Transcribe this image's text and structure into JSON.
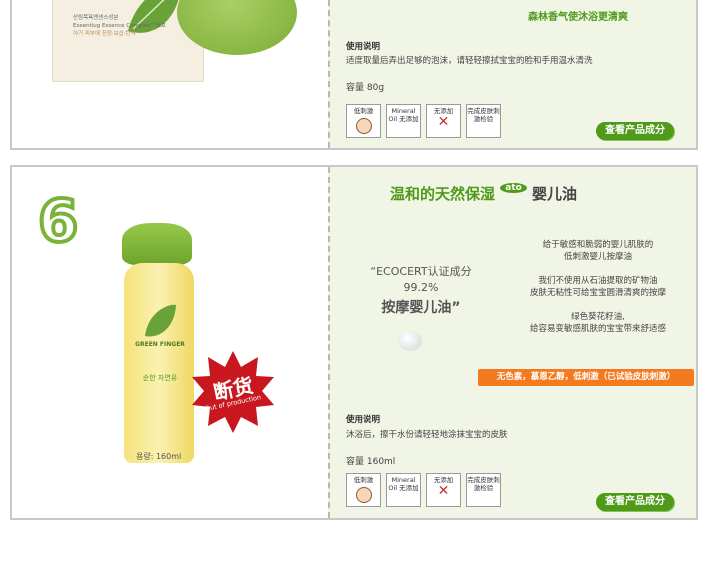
{
  "card1": {
    "tagline": "森林香气使沐浴更清爽",
    "box_text": [
      "산림목욕엔센스성분",
      "Eseentiug Essence Complex™포호",
      "아기 피부에 진정·보습·탄력"
    ],
    "usage_title": "使用说明",
    "usage_text": "适度取量后弄出足够的泡沫，请轻轻擦拭宝宝的脸和手用温水清洗",
    "capacity": "容量 80g",
    "badges": [
      "低刺激",
      "Mineral Oil 无添加",
      "无添加",
      "完成皮肤刺激检验"
    ],
    "button_label": "查看产品成分"
  },
  "card2": {
    "number": "6",
    "title_pre": "温和的天然保湿",
    "title_logo": "ato",
    "title_post": "婴儿油",
    "quote_line1": "“ECOCERT认证成分",
    "quote_line2": "99.2%",
    "quote_line3": "按摩婴儿油”",
    "desc_lines": [
      "给于敏感和脆弱的婴儿肌肤的",
      "低刺激婴儿按摩油",
      "我们不使用从石油提取的矿物油",
      "皮肤无粘性可给宝宝圆滑清爽的按摩",
      "绿色葵花籽油,",
      "给容易变敏感肌肤的宝宝带来舒适感"
    ],
    "orange_bar": "无色素，慕恩乙醇，低刺激（已试验皮肤刺激）",
    "stamp_main": "断货",
    "stamp_sub": "Out of production",
    "bottle_label_brand": "GREEN FINGER",
    "bottle_label_kr": "순한 자연유",
    "bottle_capacity": "용량: 160ml",
    "usage_title": "使用说明",
    "usage_text": "沐浴后，擦干水份请轻轻地涂抹宝宝的皮肤",
    "capacity": "容量 160ml",
    "badges": [
      "低刺激",
      "Mineral Oil 无添加",
      "无添加",
      "完成皮肤刺激检验"
    ],
    "button_label": "查看产品成分"
  },
  "colors": {
    "green": "#4f9a19",
    "orange": "#f47a1f",
    "red_stamp": "#c8171f",
    "number_green": "#7ab33a"
  }
}
